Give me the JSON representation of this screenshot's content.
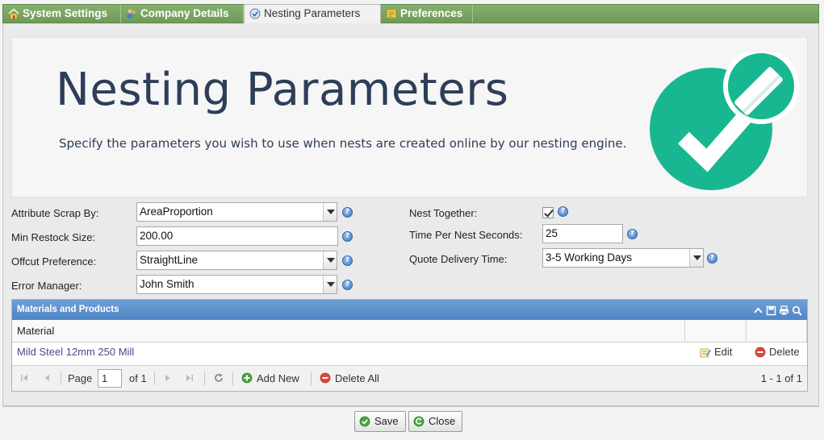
{
  "tabs": [
    {
      "label": "System Settings",
      "icon": "home-icon"
    },
    {
      "label": "Company Details",
      "icon": "people-icon"
    },
    {
      "label": "Nesting Parameters",
      "icon": "nesting-icon",
      "active": true
    },
    {
      "label": "Preferences",
      "icon": "preferences-icon"
    }
  ],
  "banner": {
    "title": "Nesting Parameters",
    "description": "Specify the parameters you wish to use when nests are created online by our nesting engine."
  },
  "form": {
    "attribute_scrap_by": {
      "label": "Attribute Scrap By:",
      "value": "AreaProportion"
    },
    "min_restock_size": {
      "label": "Min Restock Size:",
      "value": "200.00"
    },
    "offcut_preference": {
      "label": "Offcut Preference:",
      "value": "StraightLine"
    },
    "error_manager": {
      "label": "Error Manager:",
      "value": "John Smith"
    },
    "nest_together": {
      "label": "Nest Together:",
      "checked": true
    },
    "time_per_nest": {
      "label": "Time Per Nest Seconds:",
      "value": "25"
    },
    "quote_delivery": {
      "label": "Quote Delivery Time:",
      "value": "3-5 Working Days"
    }
  },
  "grid": {
    "title": "Materials and Products",
    "columns": [
      "Material",
      "",
      ""
    ],
    "rows": [
      {
        "material": "Mild Steel 12mm 250 Mill",
        "edit_label": "Edit",
        "delete_label": "Delete"
      }
    ],
    "pager": {
      "page_label": "Page",
      "page_value": "1",
      "of_label": "of 1",
      "add_new": "Add New",
      "delete_all": "Delete All",
      "summary": "1 - 1 of 1"
    }
  },
  "buttons": {
    "save": "Save",
    "close": "Close"
  },
  "colors": {
    "tab_green": "#7aa663",
    "grid_blue": "#5a8fcc",
    "check_teal": "#19b791"
  }
}
